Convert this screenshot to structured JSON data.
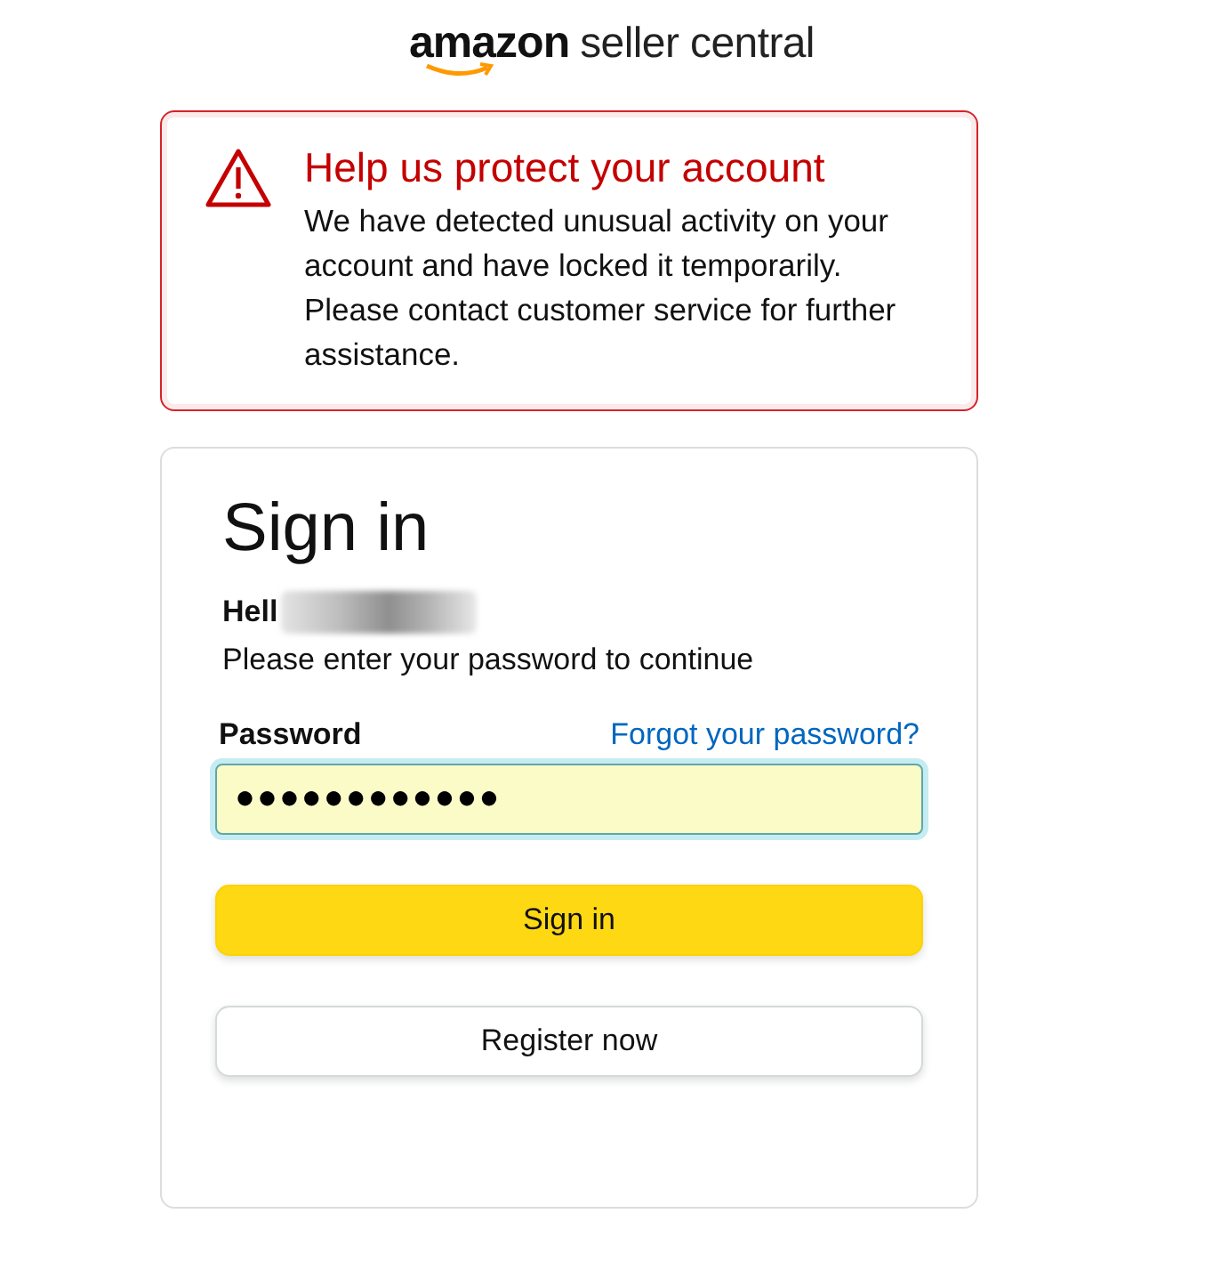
{
  "logo": {
    "brand": "amazon",
    "product": "seller central"
  },
  "alert": {
    "title": "Help us protect your account",
    "message": "We have detected unusual activity on your account and have locked it temporarily. Please contact customer service for further assistance."
  },
  "sign_in": {
    "title": "Sign in",
    "greeting": "Hell",
    "redacted": true,
    "instruction": "Please enter your password to continue",
    "password_label": "Password",
    "forgot_link": "Forgot your password?",
    "password_value": "●●●●●●●●●●●●",
    "focused": true,
    "submit_button": "Sign in",
    "register_button": "Register now"
  }
}
